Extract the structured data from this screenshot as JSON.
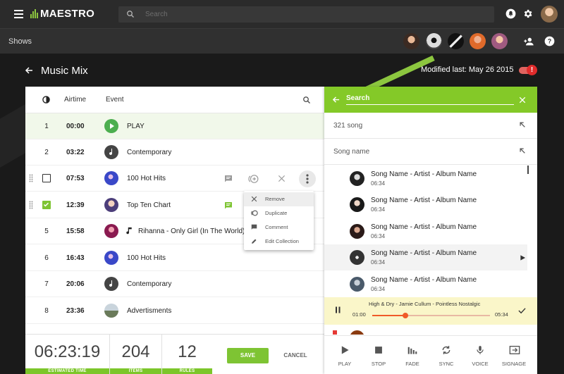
{
  "app": {
    "name": "MAESTRO"
  },
  "search": {
    "placeholder": "Search"
  },
  "secondary": {
    "label": "Shows"
  },
  "page": {
    "title": "Music Mix",
    "modified": "Modified last: May 26 2015",
    "alert_badge": "!"
  },
  "table": {
    "headers": {
      "airtime": "Airtime",
      "event": "Event"
    },
    "rows": [
      {
        "num": "1",
        "time": "00:00",
        "event": "PLAY"
      },
      {
        "num": "2",
        "time": "03:22",
        "event": "Contemporary"
      },
      {
        "num": "",
        "time": "07:53",
        "event": "100 Hot Hits"
      },
      {
        "num": "",
        "time": "12:39",
        "event": "Top Ten Chart"
      },
      {
        "num": "5",
        "time": "15:58",
        "event": "Rihanna - Only Girl (In The World)"
      },
      {
        "num": "6",
        "time": "16:43",
        "event": "100 Hot Hits"
      },
      {
        "num": "7",
        "time": "20:06",
        "event": "Contemporary"
      },
      {
        "num": "8",
        "time": "23:36",
        "event": "Advertisments"
      }
    ]
  },
  "context_menu": {
    "items": [
      "Remove",
      "Duplicate",
      "Comment",
      "Edit Collection"
    ]
  },
  "footer": {
    "estimated_time": "06:23:19",
    "estimated_time_label": "ESTIMATED TIME",
    "items": "204",
    "items_label": "ITEMS",
    "rules": "12",
    "rules_label": "RULES",
    "save": "SAVE",
    "cancel": "CANCEL"
  },
  "right_panel": {
    "search_title": "Search",
    "filters": [
      "321 song",
      "Song name"
    ],
    "songs": [
      {
        "title": "Song Name - Artist - Album Name",
        "duration": "06:34"
      },
      {
        "title": "Song Name - Artist - Album Name",
        "duration": "06:34"
      },
      {
        "title": "Song Name - Artist - Album Name",
        "duration": "06:34"
      },
      {
        "title": "Song Name - Artist - Album Name",
        "duration": "06:34"
      },
      {
        "title": "Song Name - Artist - Album Name",
        "duration": "06:34"
      }
    ],
    "player": {
      "title": "High & Dry - Jamie Cullum - Pointless Nostalgic",
      "current": "01:00",
      "total": "05:34",
      "progress": 0.28
    },
    "actions": [
      "PLAY",
      "STOP",
      "FADE",
      "SYNC",
      "VOICE",
      "SIGNAGE"
    ]
  },
  "colors": {
    "accent": "#84c928",
    "progress": "#f05a28",
    "alert": "#e02b2b"
  }
}
